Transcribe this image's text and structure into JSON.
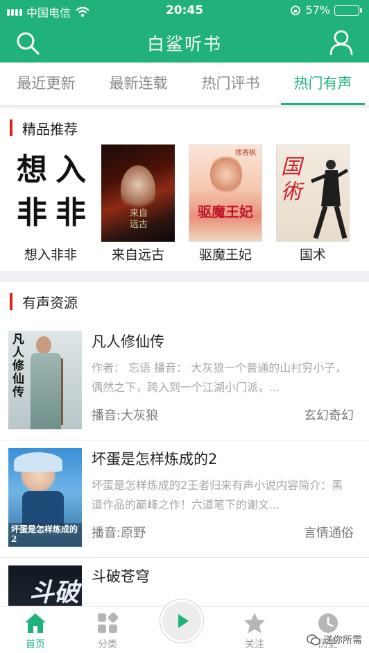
{
  "status_bar": {
    "carrier": "中国电信",
    "time": "20:45",
    "battery": "57%",
    "battery_level": 0.57
  },
  "header": {
    "title": "白鲨听书",
    "search_icon": "search-icon",
    "user_icon": "user-icon"
  },
  "tabs": [
    {
      "label": "最近更新",
      "active": false
    },
    {
      "label": "最新连载",
      "active": false
    },
    {
      "label": "热门评书",
      "active": false
    },
    {
      "label": "热门有声",
      "active": true
    }
  ],
  "featured": {
    "title": "精品推荐",
    "items": [
      {
        "title": "想入非非",
        "cover_text": [
          "想",
          "入",
          "非",
          "非"
        ]
      },
      {
        "title": "来自远古",
        "cover_text": [
          "来自",
          "远古"
        ]
      },
      {
        "title": "驱魔王妃",
        "cover_text": [
          "驱魔王妃",
          "楼香枫"
        ]
      },
      {
        "title": "国术",
        "cover_text": [
          "国",
          "術"
        ]
      }
    ]
  },
  "audio": {
    "title": "有声资源",
    "items": [
      {
        "title": "凡人修仙传",
        "desc": "作者： 忘语 播音： 大灰狼一个普通的山村穷小子，偶然之下，跨入到一个江湖小门派，...",
        "narrator": "播音:大灰狼",
        "genre": "玄幻奇幻",
        "cover_text": "凡人修仙传"
      },
      {
        "title": "坏蛋是怎样炼成的2",
        "desc": "坏蛋是怎样炼成的2王者归来有声小说内容简介：黑道作品的巅峰之作！六道笔下的谢文...",
        "narrator": "播音:原野",
        "genre": "言情通俗",
        "cover_text": "坏蛋是怎样炼成的2"
      },
      {
        "title": "斗破苍穹",
        "desc": "",
        "narrator": "",
        "genre": "",
        "cover_text": "斗破"
      }
    ]
  },
  "bottom_nav": [
    {
      "label": "首页",
      "icon": "home-icon",
      "active": true
    },
    {
      "label": "分类",
      "icon": "category-icon",
      "active": false
    },
    {
      "label": "关注",
      "icon": "star-icon",
      "active": false
    },
    {
      "label": "历史",
      "icon": "clock-icon",
      "active": false
    }
  ],
  "play_icon": "play-icon",
  "watermark": "送你所需",
  "colors": {
    "brand": "#20b27a",
    "accent_bar": "#e02020",
    "muted": "#8a8a8a"
  }
}
